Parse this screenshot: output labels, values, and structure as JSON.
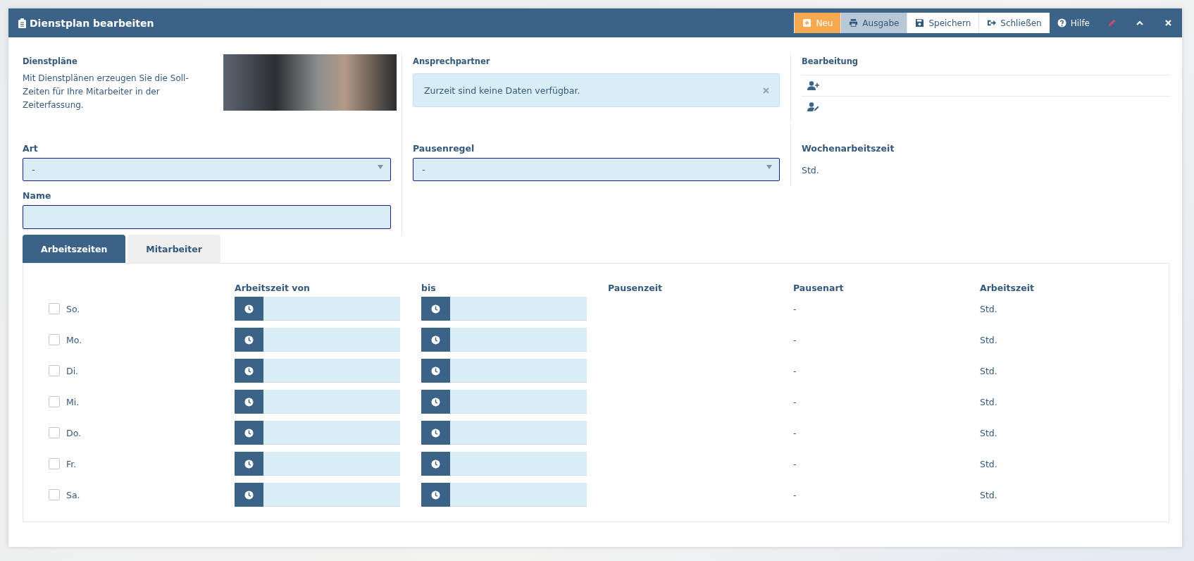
{
  "window": {
    "title": "Dienstplan bearbeiten"
  },
  "toolbar": [
    {
      "kind": "new",
      "label": "Neu"
    },
    {
      "kind": "print",
      "label": "Ausgabe"
    },
    {
      "kind": "save",
      "label": "Speichern"
    },
    {
      "kind": "close",
      "label": "Schließen"
    },
    {
      "kind": "help",
      "label": "Hilfe"
    }
  ],
  "intro": {
    "title": "Dienstpläne",
    "text": "Mit Dienstplänen erzeugen Sie die Soll-Zeiten für Ihre Mitarbeiter in der Zeiterfassung."
  },
  "contacts": {
    "title": "Ansprechpartner",
    "alert": "Zurzeit sind keine Daten verfügbar."
  },
  "editing": {
    "title": "Bearbeitung"
  },
  "form": {
    "art": {
      "label": "Art",
      "value": "-"
    },
    "pausenregel": {
      "label": "Pausenregel",
      "value": "-"
    },
    "name": {
      "label": "Name"
    },
    "wochenarbeitszeit": {
      "label": "Wochenarbeitszeit",
      "value": "Std."
    }
  },
  "tabs": [
    {
      "label": "Arbeitszeiten",
      "selected": true
    },
    {
      "label": "Mitarbeiter",
      "selected": false
    }
  ],
  "table": {
    "columns": [
      "Arbeitszeit von",
      "bis",
      "Pausenzeit",
      "Pausenart",
      "Arbeitszeit"
    ],
    "rows": [
      {
        "day": "So.",
        "checked": false,
        "pausenart": "-",
        "arbeitszeit": "Std."
      },
      {
        "day": "Mo.",
        "checked": false,
        "pausenart": "-",
        "arbeitszeit": "Std."
      },
      {
        "day": "Di.",
        "checked": false,
        "pausenart": "-",
        "arbeitszeit": "Std."
      },
      {
        "day": "Mi.",
        "checked": false,
        "pausenart": "-",
        "arbeitszeit": "Std."
      },
      {
        "day": "Do.",
        "checked": false,
        "pausenart": "-",
        "arbeitszeit": "Std."
      },
      {
        "day": "Fr.",
        "checked": false,
        "pausenart": "-",
        "arbeitszeit": "Std."
      },
      {
        "day": "Sa.",
        "checked": false,
        "pausenart": "-",
        "arbeitszeit": "Std."
      }
    ]
  }
}
